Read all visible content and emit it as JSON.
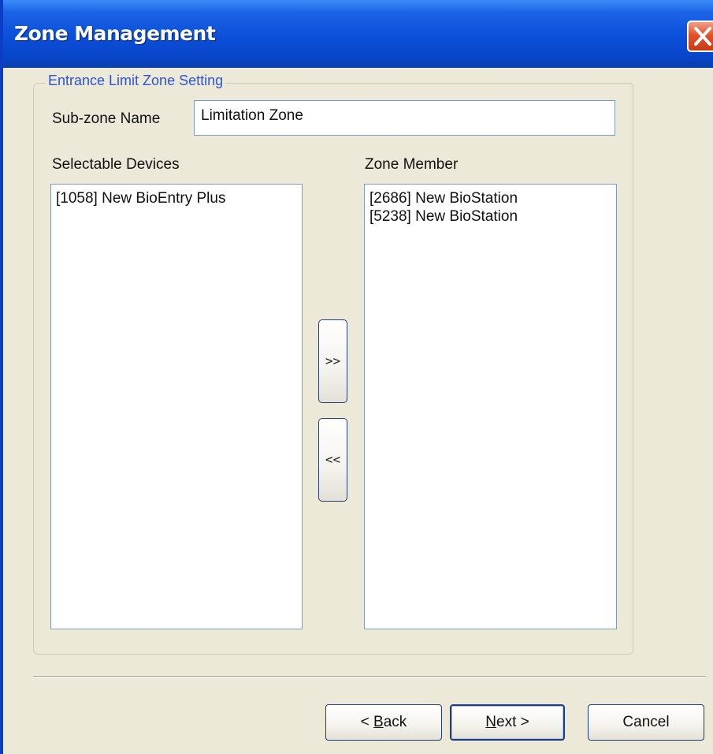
{
  "window": {
    "title": "Zone Management"
  },
  "group": {
    "label": "Entrance Limit Zone Setting"
  },
  "subzone": {
    "label": "Sub-zone Name",
    "value": "Limitation Zone"
  },
  "selectable": {
    "label": "Selectable Devices",
    "items": [
      "[1058] New BioEntry Plus"
    ]
  },
  "member": {
    "label": "Zone Member",
    "items": [
      "[2686] New BioStation",
      "[5238] New BioStation"
    ]
  },
  "move": {
    "add_label": ">>",
    "remove_label": "<<"
  },
  "buttons": {
    "back_prefix": "< ",
    "back_mnemonic": "B",
    "back_rest": "ack",
    "next_mnemonic": "N",
    "next_rest": "ext >",
    "cancel": "Cancel"
  },
  "colors": {
    "titlebar": "#0a4fd8",
    "group_label": "#2b55d6",
    "dialog_bg": "#ece9d8",
    "close_button": "#e2532d"
  },
  "icons": {
    "close": "close-x-icon"
  }
}
